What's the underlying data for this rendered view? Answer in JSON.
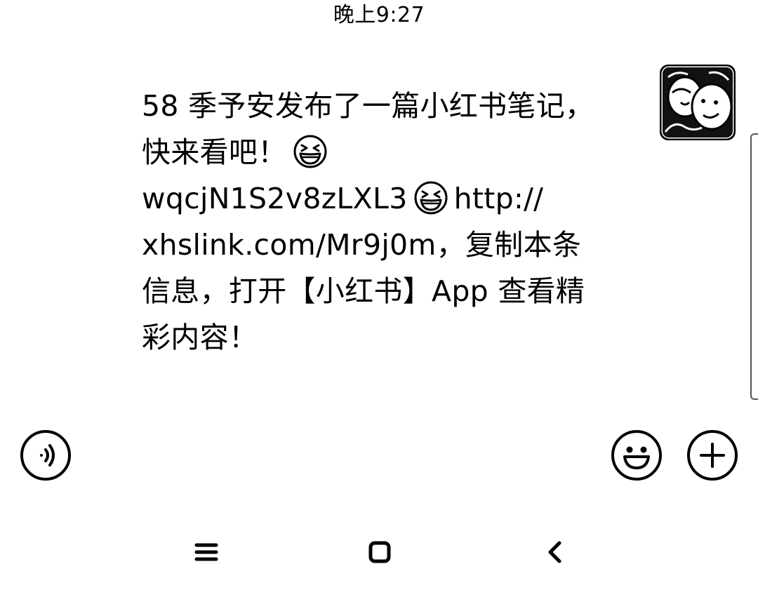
{
  "status_bar": {
    "time": "晚上9:27"
  },
  "message": {
    "lines": [
      "58 季予安发布了一篇小红书笔记，",
      "快来看吧！",
      "wqcjN1S2v8zLXL3",
      "http://",
      "xhslink.com/Mr9j0m，复制本条",
      "信息，打开【小红书】App 查看精",
      "彩内容！"
    ]
  },
  "input_bar": {
    "voice_icon": "voice-icon",
    "emoji_icon": "emoji-icon",
    "plus_icon": "plus-icon"
  },
  "nav_bar": {
    "menu_icon": "menu-icon",
    "home_icon": "home-icon",
    "back_icon": "back-icon"
  }
}
